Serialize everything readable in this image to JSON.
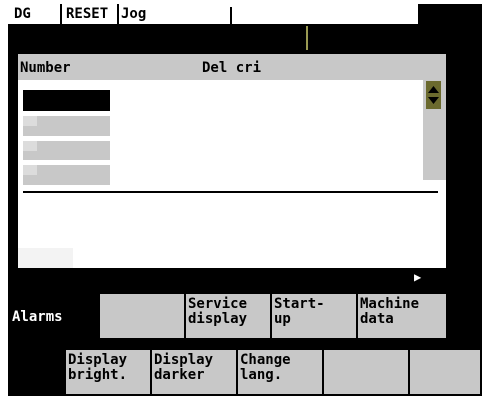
{
  "header": {
    "channel": "DG",
    "reset": "RESET",
    "mode": "Jog"
  },
  "alarm_list": {
    "col_number": "Number",
    "col_description": "Del cri"
  },
  "more_indicator": "▶",
  "softkeys_top": [
    {
      "line1": "Alarms",
      "line2": ""
    },
    {
      "line1": "",
      "line2": ""
    },
    {
      "line1": "Service",
      "line2": "display"
    },
    {
      "line1": "Start-",
      "line2": "up"
    },
    {
      "line1": "Machine",
      "line2": "data"
    }
  ],
  "softkeys_bottom": [
    {
      "line1": "",
      "line2": ""
    },
    {
      "line1": "Display",
      "line2": "bright."
    },
    {
      "line1": "Display",
      "line2": "darker"
    },
    {
      "line1": "Change",
      "line2": "lang."
    },
    {
      "line1": "",
      "line2": ""
    },
    {
      "line1": "",
      "line2": ""
    }
  ],
  "colors": {
    "panel": "#c8c8c8",
    "background": "#000000",
    "header_bg": "#ffffff",
    "scroll_thumb": "#6b6a2e",
    "olive_line": "#9a9a52"
  }
}
